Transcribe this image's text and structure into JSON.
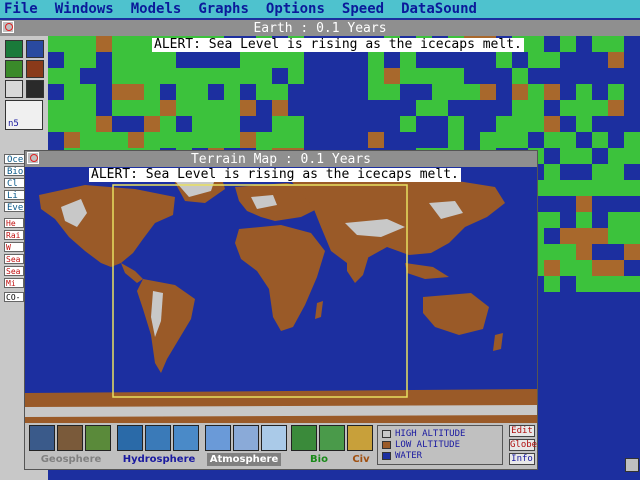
{
  "menu": {
    "items": [
      "File",
      "Windows",
      "Models",
      "Graphs",
      "Options",
      "Speed",
      "DataSound"
    ]
  },
  "earth_window": {
    "title": "Earth : 0.1 Years",
    "alert": "ALERT: Sea Level is rising as the icecaps melt."
  },
  "sidebar": {
    "count_label": "n5",
    "buttons": [
      "Oceans",
      "Bio",
      "Cl",
      "Li",
      "Eve"
    ],
    "red_labels": [
      "He",
      "Rai",
      "W",
      "Sea",
      "Sea",
      "Mi"
    ],
    "bottom_label": "CO-E"
  },
  "terrain_window": {
    "title": "Terrain Map : 0.1 Years",
    "alert": "ALERT: Sea Level is rising as the icecaps melt."
  },
  "toolbar": {
    "groups": [
      "Geosphere",
      "Hydrosphere",
      "Atmosphere",
      "Bio",
      "Civ"
    ],
    "legend": [
      {
        "label": "HIGH ALTITUDE",
        "color": "#c8c8c8"
      },
      {
        "label": "LOW ALTITUDE",
        "color": "#9a5a28"
      },
      {
        "label": "WATER",
        "color": "#1c2fa0"
      }
    ],
    "buttons": [
      "Edit",
      "Globe",
      "Info"
    ]
  },
  "colors": {
    "ocean": "#1c2f9f",
    "land_green": "#3cc23c",
    "land_brown": "#a8682c",
    "high_alt": "#c8c8c8",
    "selection": "#e8e060"
  }
}
